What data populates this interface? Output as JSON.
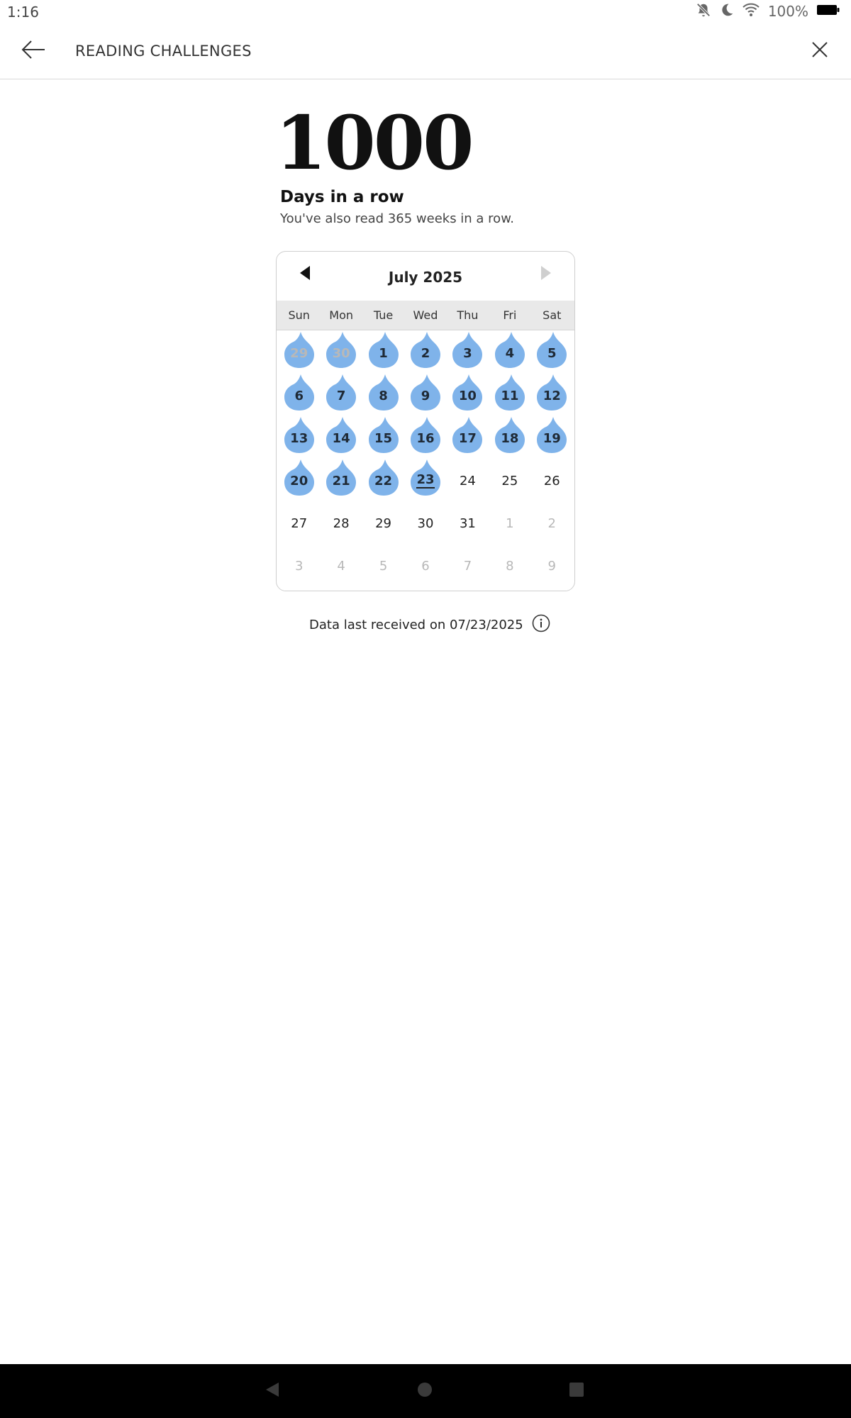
{
  "status_bar": {
    "time": "1:16",
    "battery_percent": "100%",
    "icons": [
      "notifications-off-icon",
      "moon-icon",
      "wifi-icon",
      "battery-icon"
    ]
  },
  "app_bar": {
    "title": "READING CHALLENGES",
    "back_icon": "arrow-left-icon",
    "close_icon": "close-icon"
  },
  "streak": {
    "count": "1000",
    "label": "Days in a row",
    "subtext": "You've also read 365 weeks in a row."
  },
  "calendar": {
    "month_title": "July 2025",
    "prev_enabled": true,
    "next_enabled": false,
    "weekdays": [
      "Sun",
      "Mon",
      "Tue",
      "Wed",
      "Thu",
      "Fri",
      "Sat"
    ],
    "days": [
      {
        "label": "29",
        "in_month": false,
        "read": true
      },
      {
        "label": "30",
        "in_month": false,
        "read": true
      },
      {
        "label": "1",
        "in_month": true,
        "read": true
      },
      {
        "label": "2",
        "in_month": true,
        "read": true
      },
      {
        "label": "3",
        "in_month": true,
        "read": true
      },
      {
        "label": "4",
        "in_month": true,
        "read": true
      },
      {
        "label": "5",
        "in_month": true,
        "read": true
      },
      {
        "label": "6",
        "in_month": true,
        "read": true
      },
      {
        "label": "7",
        "in_month": true,
        "read": true
      },
      {
        "label": "8",
        "in_month": true,
        "read": true
      },
      {
        "label": "9",
        "in_month": true,
        "read": true
      },
      {
        "label": "10",
        "in_month": true,
        "read": true
      },
      {
        "label": "11",
        "in_month": true,
        "read": true
      },
      {
        "label": "12",
        "in_month": true,
        "read": true
      },
      {
        "label": "13",
        "in_month": true,
        "read": true
      },
      {
        "label": "14",
        "in_month": true,
        "read": true
      },
      {
        "label": "15",
        "in_month": true,
        "read": true
      },
      {
        "label": "16",
        "in_month": true,
        "read": true
      },
      {
        "label": "17",
        "in_month": true,
        "read": true
      },
      {
        "label": "18",
        "in_month": true,
        "read": true
      },
      {
        "label": "19",
        "in_month": true,
        "read": true
      },
      {
        "label": "20",
        "in_month": true,
        "read": true
      },
      {
        "label": "21",
        "in_month": true,
        "read": true
      },
      {
        "label": "22",
        "in_month": true,
        "read": true
      },
      {
        "label": "23",
        "in_month": true,
        "read": true,
        "today": true
      },
      {
        "label": "24",
        "in_month": true,
        "read": false
      },
      {
        "label": "25",
        "in_month": true,
        "read": false
      },
      {
        "label": "26",
        "in_month": true,
        "read": false
      },
      {
        "label": "27",
        "in_month": true,
        "read": false
      },
      {
        "label": "28",
        "in_month": true,
        "read": false
      },
      {
        "label": "29",
        "in_month": true,
        "read": false
      },
      {
        "label": "30",
        "in_month": true,
        "read": false
      },
      {
        "label": "31",
        "in_month": true,
        "read": false
      },
      {
        "label": "1",
        "in_month": false,
        "read": false
      },
      {
        "label": "2",
        "in_month": false,
        "read": false
      },
      {
        "label": "3",
        "in_month": false,
        "read": false
      },
      {
        "label": "4",
        "in_month": false,
        "read": false
      },
      {
        "label": "5",
        "in_month": false,
        "read": false
      },
      {
        "label": "6",
        "in_month": false,
        "read": false
      },
      {
        "label": "7",
        "in_month": false,
        "read": false
      },
      {
        "label": "8",
        "in_month": false,
        "read": false
      },
      {
        "label": "9",
        "in_month": false,
        "read": false
      }
    ]
  },
  "footer": {
    "data_last_received": "Data last received on 07/23/2025",
    "info_icon": "info-icon"
  },
  "nav_bar": {
    "icons": [
      "back-triangle-icon",
      "home-circle-icon",
      "recents-square-icon"
    ]
  },
  "colors": {
    "streak_flame": "#7fb3ea",
    "text_primary": "#111111",
    "muted_day": "#b8b8b8",
    "weekday_bg": "#e9e9e9",
    "nav_bar_bg": "#000000"
  }
}
